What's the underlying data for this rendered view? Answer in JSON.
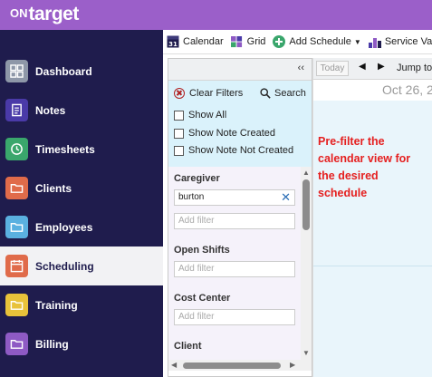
{
  "app": {
    "logo_prefix": "ON",
    "logo_main": "target",
    "brand_color": "#9b5fc9",
    "sidebar_color": "#1f1c4d"
  },
  "sidebar": {
    "items": [
      {
        "label": "Dashboard",
        "icon": "dashboard-icon",
        "color": "#8e97a8"
      },
      {
        "label": "Notes",
        "icon": "notes-icon",
        "color": "#4a3aa8"
      },
      {
        "label": "Timesheets",
        "icon": "clock-icon",
        "color": "#3aa66c"
      },
      {
        "label": "Clients",
        "icon": "folder-icon",
        "color": "#e06b4a"
      },
      {
        "label": "Employees",
        "icon": "folder-icon",
        "color": "#5ab0e0"
      },
      {
        "label": "Scheduling",
        "icon": "calendar-icon",
        "color": "#e06b4a",
        "active": true
      },
      {
        "label": "Training",
        "icon": "folder-icon",
        "color": "#e8c23a"
      },
      {
        "label": "Billing",
        "icon": "folder-icon",
        "color": "#8e5ac4"
      }
    ]
  },
  "toolbar": {
    "calendar_label": "Calendar",
    "calendar_icon_text": "31",
    "grid_label": "Grid",
    "add_schedule_label": "Add Schedule",
    "service_label": "Service Var"
  },
  "filter_panel": {
    "collapse_label": "‹‹",
    "clear_filters_label": "Clear Filters",
    "search_label": "Search",
    "checkboxes": [
      "Show All",
      "Show Note Created",
      "Show Note Not Created"
    ],
    "caregiver": {
      "title": "Caregiver",
      "value": "burton",
      "placeholder": "Add filter"
    },
    "open_shifts": {
      "title": "Open Shifts",
      "placeholder": "Add filter"
    },
    "cost_center": {
      "title": "Cost Center",
      "placeholder": "Add filter"
    },
    "client": {
      "title": "Client"
    }
  },
  "calendar": {
    "today_label": "Today",
    "jump_label": "Jump to:",
    "date_label": "Oct 26, 2"
  },
  "annotation": {
    "text": "Pre-filter the calendar view for the desired schedule",
    "color": "#e52020"
  }
}
